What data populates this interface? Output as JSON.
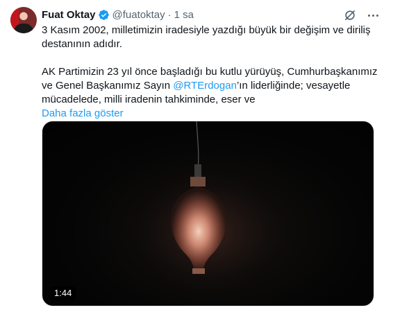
{
  "author": {
    "name": "Fuat Oktay",
    "handle": "@fuatoktay",
    "separator": "·",
    "time": "1 sa"
  },
  "tweet": {
    "line1": "3 Kasım 2002, milletimizin iradesiyle yazdığı büyük bir değişim ve diriliş destanının adıdır.",
    "line2_before": "AK Partimizin 23 yıl önce başladığı bu kutlu yürüyüş, Cumhurbaşkanımız ve Genel Başkanımız Sayın ",
    "mention": "@RTErdogan",
    "line2_after": "’ın liderliğinde; vesayetle mücadelede, milli iradenin tahkiminde, eser ve",
    "show_more": "Daha fazla göster"
  },
  "media": {
    "duration": "1:44",
    "description_icon": "light-bulb-video"
  },
  "icons": {
    "verified": "verified-badge-icon",
    "grok": "grok-icon",
    "more": "more-options-icon"
  },
  "colors": {
    "link": "#1d9bf0",
    "secondary_text": "#536471",
    "verified": "#1d9bf0"
  }
}
